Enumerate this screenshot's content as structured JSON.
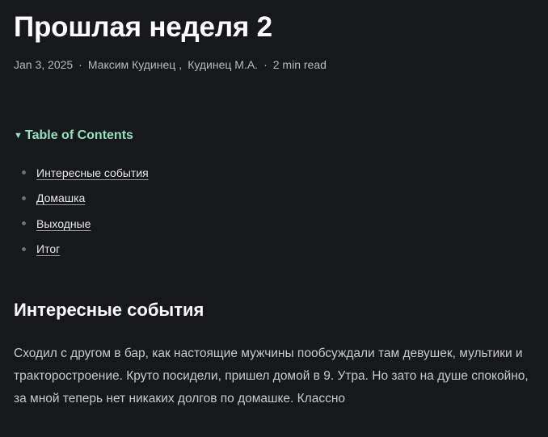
{
  "post": {
    "title": "Прошлая неделя 2",
    "meta": {
      "date": "Jan 3, 2025",
      "separator": "·",
      "authors": [
        "Максим Кудинец",
        "Кудинец М.А."
      ],
      "author_separator": ",",
      "read_time": "2 min read"
    }
  },
  "toc": {
    "caret": "▼",
    "title": "Table of Contents",
    "items": [
      {
        "label": "Интересные события"
      },
      {
        "label": "Домашка"
      },
      {
        "label": "Выходные"
      },
      {
        "label": "Итог"
      }
    ]
  },
  "section": {
    "heading": "Интересные события",
    "paragraph": "Сходил с другом в бар, как настоящие мужчины пообсуждали там девушек, мультики и тракторостроение. Круто посидели, пришел домой в 9. Утра. Но зато на душе спокойно, за мной теперь нет никаких долгов по домашке. Классно"
  },
  "colors": {
    "background": "#17181c",
    "accent": "#8fe3bf",
    "text": "#e8e8ea",
    "muted": "#b8b9bf"
  }
}
